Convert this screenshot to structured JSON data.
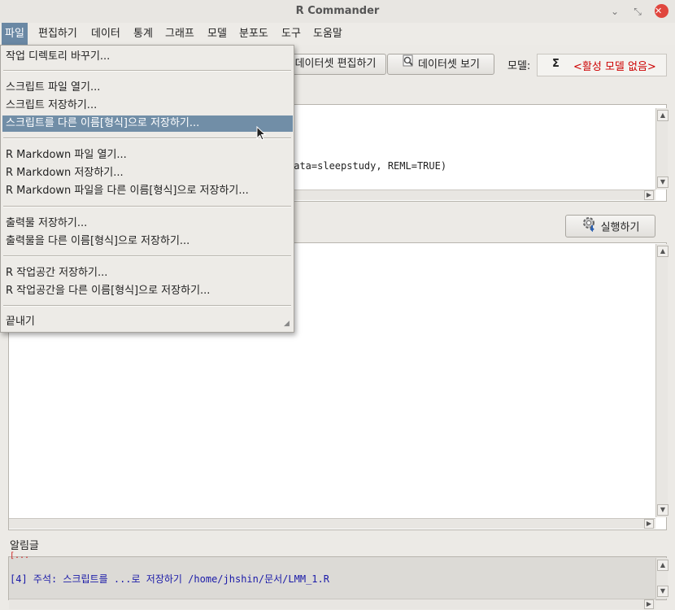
{
  "window": {
    "title": "R Commander",
    "minimize": "⌄",
    "maximize": "⤡",
    "close": "✕"
  },
  "menubar": [
    "파일",
    "편집하기",
    "데이터",
    "통계",
    "그래프",
    "모델",
    "분포도",
    "도구",
    "도움말"
  ],
  "toolbar": {
    "edit_dataset": "데이터셋 편집하기",
    "view_dataset": "데이터셋 보기",
    "model_label": "모델:",
    "model_sigma": "Σ",
    "model_value": "<활성 모델 없음>"
  },
  "script": {
    "visible_line": "data=sleepstudy, REML=TRUE)"
  },
  "run_button": "실행하기",
  "notice": {
    "label": "알림글",
    "partial_line": "[...",
    "message": "[4] 주석: 스크립트를 ...로 저장하기 /home/jhshin/문서/LMM_1.R"
  },
  "file_menu": {
    "items": [
      "작업 디렉토리 바꾸기...",
      "스크립트 파일 열기...",
      "스크립트 저장하기...",
      "스크립트를 다른 이름[형식]으로 저장하기...",
      "R Markdown 파일 열기...",
      "R Markdown 저장하기...",
      "R Markdown 파일을 다른 이름[형식]으로 저장하기...",
      "출력물 저장하기...",
      "출력물을 다른 이름[형식]으로 저장하기...",
      "R 작업공간 저장하기...",
      "R 작업공간을 다른 이름[형식]으로 저장하기...",
      "끝내기"
    ]
  },
  "colors": {
    "menu_highlight": "#718ea7",
    "close_button": "#e0463e",
    "model_text": "#cc0000",
    "notice_text": "#1a1aa8"
  }
}
